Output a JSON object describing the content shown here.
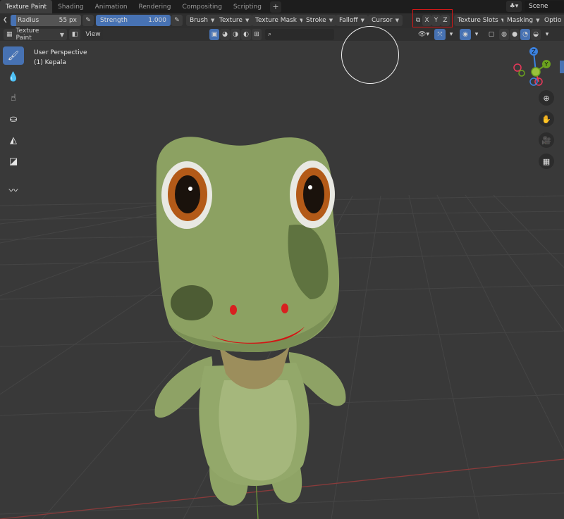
{
  "workspace_tabs": [
    "Texture Paint",
    "Shading",
    "Animation",
    "Rendering",
    "Compositing",
    "Scripting"
  ],
  "add_tab_label": "+",
  "scene": {
    "label": "Scene"
  },
  "tool_settings": {
    "radius": {
      "label": "Radius",
      "value": "55 px"
    },
    "strength": {
      "label": "Strength",
      "value": "1.000"
    },
    "menus": [
      "Brush",
      "Texture",
      "Texture Mask",
      "Stroke",
      "Falloff",
      "Cursor"
    ],
    "symmetry_axes": [
      "X",
      "Y",
      "Z"
    ],
    "texture_slots": "Texture Slots",
    "masking": "Masking",
    "options": "Optio"
  },
  "header": {
    "mode": "Texture Paint",
    "view_menu": "View"
  },
  "viewport": {
    "perspective_label": "User Perspective",
    "object_label": "(1) Kepala"
  },
  "gizmo": {
    "x": "X",
    "y": "Y",
    "z": "Z"
  },
  "colors": {
    "accent": "#4772b3",
    "highlight": "#d01818",
    "axis_x": "#e8385a",
    "axis_y": "#6ba21e",
    "axis_z": "#3b82e0"
  },
  "icons": {
    "left_tools": [
      "brush-icon",
      "soften-icon",
      "smear-icon",
      "clone-icon",
      "fill-icon",
      "mask-icon",
      "annotate-icon"
    ],
    "right_nav": [
      "zoom-icon",
      "hand-icon",
      "camera-icon",
      "grid-icon"
    ]
  }
}
